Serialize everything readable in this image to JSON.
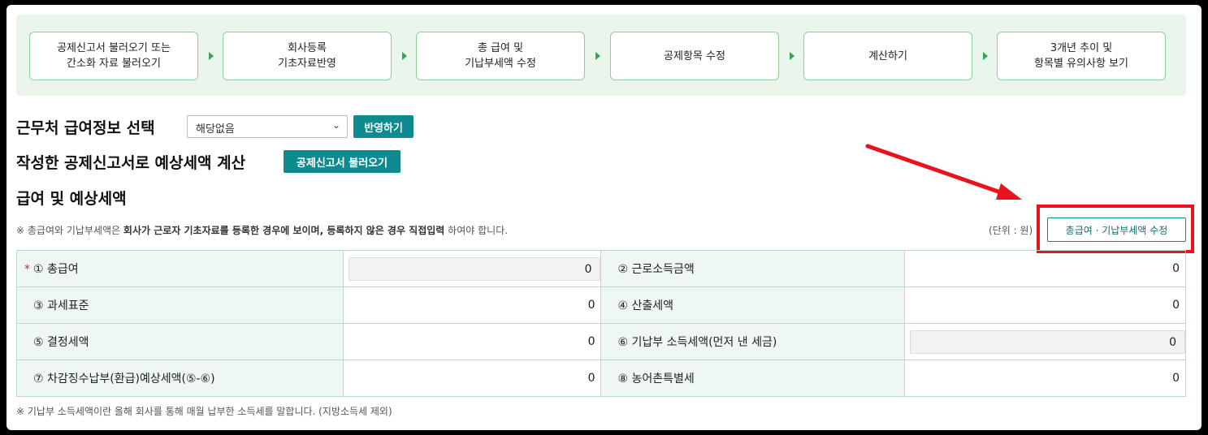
{
  "steps": [
    "공제신고서 불러오기 또는\n간소화 자료 불러오기",
    "회사등록\n기초자료반영",
    "총 급여 및\n기납부세액 수정",
    "공제항목 수정",
    "계산하기",
    "3개년 추이 및\n항목별 유의사항 보기"
  ],
  "section1": {
    "title": "근무처 급여정보 선택",
    "select_value": "해당없음",
    "apply_button": "반영하기"
  },
  "section2": {
    "title": "작성한 공제신고서로 예상세액 계산",
    "load_button": "공제신고서 불러오기"
  },
  "section3": {
    "title": "급여 및 예상세액",
    "note_prefix": "※ 총급여와 기납부세액은 ",
    "note_bold": "회사가 근로자 기초자료를 등록한 경우에 보이며, 등록하지 않은 경우 직접입력",
    "note_suffix": " 하여야 합니다.",
    "unit": "(단위 : 원)",
    "edit_button": "총급여 · 기납부세액 수정"
  },
  "table": {
    "required_mark": "*",
    "rows": [
      {
        "l1": "① 총급여",
        "v1": "0",
        "l2": "② 근로소득금액",
        "v2": "0"
      },
      {
        "l1": "③ 과세표준",
        "v1": "0",
        "l2": "④ 산출세액",
        "v2": "0"
      },
      {
        "l1": "⑤ 결정세액",
        "v1": "0",
        "l2": "⑥ 기납부 소득세액(먼저 낸 세금)",
        "v2": "0"
      },
      {
        "l1": "⑦ 차감징수납부(환급)예상세액(⑤-⑥)",
        "v1": "0",
        "l2": "⑧ 농어촌특별세",
        "v2": "0"
      }
    ]
  },
  "footnote": "※ 기납부 소득세액이란 올해 회사를 통해 매월 납부한 소득세를 말합니다. (지방소득세 제외)",
  "colors": {
    "teal": "#0f8a8f",
    "highlight": "#e8141c",
    "step_border": "#8fcf9a"
  },
  "icons": {
    "select": "chevron-down-icon",
    "step_separator": "triangle-right-icon",
    "annotation": "red-arrow-icon"
  }
}
